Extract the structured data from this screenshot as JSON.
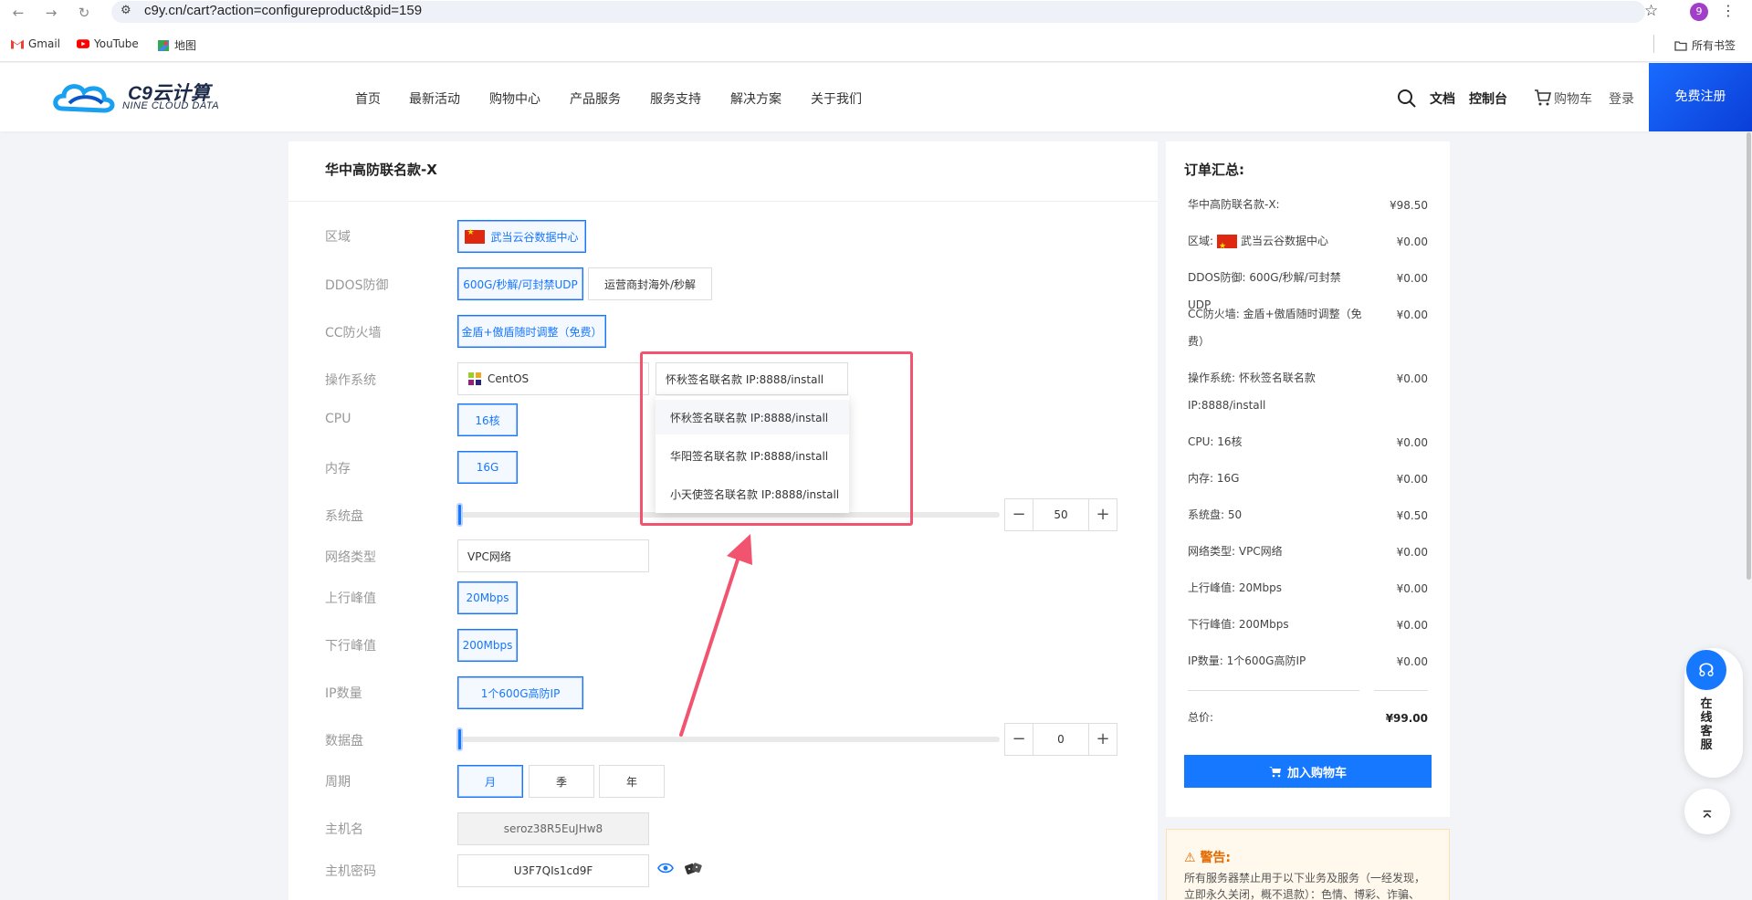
{
  "browser": {
    "url": "c9y.cn/cart?action=configureproduct&pid=159",
    "profile_initial": "9",
    "bookmarks": [
      {
        "label": "Gmail"
      },
      {
        "label": "YouTube"
      },
      {
        "label": "地图"
      }
    ],
    "all_bookmarks": "所有书签"
  },
  "header": {
    "logo_name": "C9云计算",
    "logo_sub": "NINE CLOUD DATA",
    "menu": [
      "首页",
      "最新活动",
      "购物中心",
      "产品服务",
      "服务支持",
      "解决方案",
      "关于我们"
    ],
    "docs": "文档",
    "console": "控制台",
    "cart": "购物车",
    "login": "登录",
    "register": "免费注册"
  },
  "config": {
    "title": "华中高防联名款-X",
    "labels": {
      "region": "区域",
      "ddos": "DDOS防御",
      "cc": "CC防火墙",
      "os": "操作系统",
      "cpu": "CPU",
      "memory": "内存",
      "system_disk": "系统盘",
      "network_type": "网络类型",
      "upstream": "上行峰值",
      "downstream": "下行峰值",
      "ip_count": "IP数量",
      "data_disk": "数据盘",
      "period": "周期",
      "hostname": "主机名",
      "password": "主机密码"
    },
    "region_option": "武当云谷数据中心",
    "ddos_options": [
      "600G/秒解/可封禁UDP",
      "运营商封海外/秒解"
    ],
    "cc_option": "金盾+傲盾随时调整（免费）",
    "os_family": "CentOS",
    "os_version": "怀秋签名联名款 IP:8888/install",
    "os_dropdown": [
      "怀秋签名联名款 IP:8888/install",
      "华阳签名联名款 IP:8888/install",
      "小天使签名联名款 IP:8888/install"
    ],
    "cpu_option": "16核",
    "memory_option": "16G",
    "system_disk_value": "50",
    "network_type_value": "VPC网络",
    "upstream_option": "20Mbps",
    "downstream_option": "200Mbps",
    "ip_option": "1个600G高防IP",
    "data_disk_value": "0",
    "period_options": [
      "月",
      "季",
      "年"
    ],
    "hostname_value": "seroz38R5EuJHw8",
    "password_value": "U3F7QIs1cd9F"
  },
  "summary": {
    "title": "订单汇总:",
    "rows": [
      {
        "label": "华中高防联名款-X:",
        "value": "¥98.50"
      },
      {
        "label": "区域: ",
        "flag": true,
        "label2": " 武当云谷数据中心",
        "value": "¥0.00"
      },
      {
        "label": "DDOS防御: 600G/秒解/可封禁UDP",
        "value": "¥0.00"
      },
      {
        "label": "CC防火墙: 金盾+傲盾随时调整（免费）",
        "value": "¥0.00"
      },
      {
        "label": "操作系统: 怀秋签名联名款 IP:8888/install",
        "value": "¥0.00"
      },
      {
        "label": "CPU: 16核",
        "value": "¥0.00"
      },
      {
        "label": "内存: 16G",
        "value": "¥0.00"
      },
      {
        "label": "系统盘: 50",
        "value": "¥0.50"
      },
      {
        "label": "网络类型: VPC网络",
        "value": "¥0.00"
      },
      {
        "label": "上行峰值: 20Mbps",
        "value": "¥0.00"
      },
      {
        "label": "下行峰值: 200Mbps",
        "value": "¥0.00"
      },
      {
        "label": "IP数量: 1个600G高防IP",
        "value": "¥0.00"
      }
    ],
    "total_label": "总价:",
    "total_value": "¥99.00",
    "add_to_cart": "加入购物车"
  },
  "warning": {
    "title": "警告:",
    "text": "所有服务器禁止用于以下业务及服务（一经发现，立即永久关闭，概不退款）：色情、博彩、诈骗、"
  },
  "float": {
    "service_text": "在线客服"
  },
  "colors": {
    "accent": "#1677ff",
    "annotation": "#f2536f"
  }
}
